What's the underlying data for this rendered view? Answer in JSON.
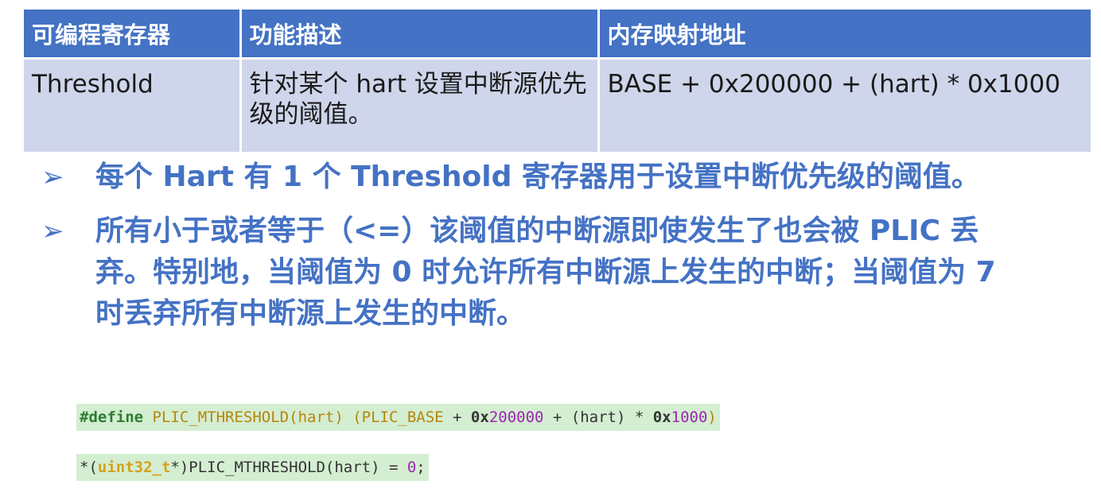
{
  "table": {
    "headers": [
      "可编程寄存器",
      "功能描述",
      "内存映射地址"
    ],
    "row": {
      "register": "Threshold",
      "description": "针对某个 hart 设置中断源优先级的阈值。",
      "address": "BASE + 0x200000 + (hart) * 0x1000"
    }
  },
  "bullets": [
    "每个 Hart 有 1 个 Threshold 寄存器用于设置中断优先级的阈值。",
    "所有小于或者等于（<=）该阈值的中断源即使发生了也会被 PLIC 丢弃。特别地，当阈值为 0 时允许所有中断源上发生的中断；当阈值为 7 时丢弃所有中断源上发生的中断。"
  ],
  "bullet_symbol": "➢",
  "code": {
    "line1": {
      "directive": "#define",
      "macro": "PLIC_MTHRESHOLD",
      "args": "(hart) (",
      "base": "PLIC_BASE",
      "plus1": " + ",
      "hex1_prefix": "0x",
      "hex1_digits": "200000",
      "mid": " + (hart) * ",
      "hex2_prefix": "0x",
      "hex2_digits": "1000",
      "close": ")"
    },
    "line2": {
      "open": "*(",
      "type": "uint32_t",
      "cast_close": "*)",
      "macro_call": "PLIC_MTHRESHOLD(hart) = ",
      "value": "0",
      "end": ";"
    }
  },
  "colors": {
    "header_bg": "#4472c4",
    "row_bg": "#cfd5ea",
    "bullet_text": "#4472c4",
    "code_bg": "#d4eed2"
  }
}
